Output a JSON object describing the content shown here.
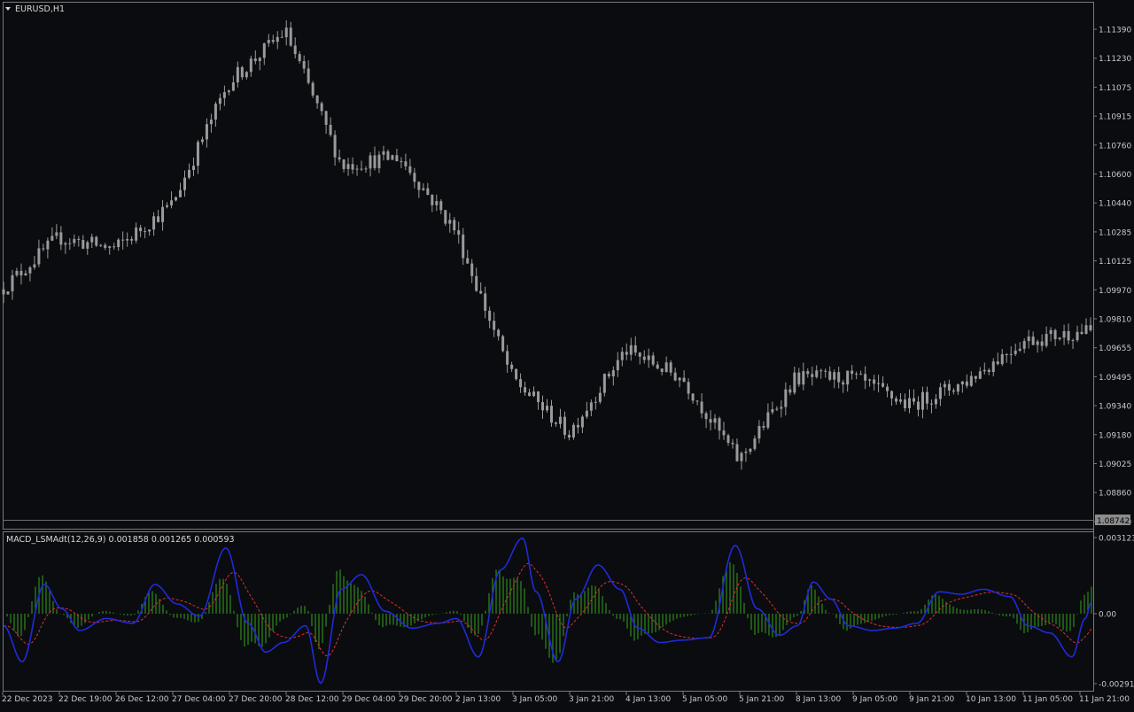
{
  "main_pane": {
    "title": "EURUSD,H1",
    "price_levels": [
      "1.11390",
      "1.11230",
      "1.11075",
      "1.10915",
      "1.10760",
      "1.10600",
      "1.10440",
      "1.10285",
      "1.10125",
      "1.09970",
      "1.09810",
      "1.09655",
      "1.09495",
      "1.09340",
      "1.09180",
      "1.09025",
      "1.08860",
      "1.08700"
    ],
    "current_price": "1.08742"
  },
  "indicator_pane": {
    "title": "MACD_LSMAdt(12,26,9) 0.001858 0.001265 0.000593",
    "levels": [
      "0.003123",
      "0.00",
      "-0.002914"
    ]
  },
  "time_axis": {
    "labels": [
      "22 Dec 2023",
      "22 Dec 19:00",
      "26 Dec 12:00",
      "27 Dec 04:00",
      "27 Dec 20:00",
      "28 Dec 12:00",
      "29 Dec 04:00",
      "29 Dec 20:00",
      "2 Jan 13:00",
      "3 Jan 05:00",
      "3 Jan 21:00",
      "4 Jan 13:00",
      "5 Jan 05:00",
      "5 Jan 21:00",
      "8 Jan 13:00",
      "9 Jan 05:00",
      "9 Jan 21:00",
      "10 Jan 13:00",
      "11 Jan 05:00",
      "11 Jan 21:00"
    ]
  },
  "colors": {
    "background": "#0b0c10",
    "candle": "#9a9a9a",
    "macd_line": "#1f2bd8",
    "signal_line": "#e0302a",
    "histogram": "#2f8a1c",
    "text": "#c8c8c8",
    "border": "#7a7a7a"
  },
  "chart_data": {
    "type": "line",
    "title": "EURUSD,H1",
    "ylim": [
      1.087,
      1.1147
    ],
    "x": [
      "22 Dec 2023",
      "22 Dec 19:00",
      "26 Dec 12:00",
      "27 Dec 04:00",
      "27 Dec 20:00",
      "28 Dec 12:00",
      "29 Dec 04:00",
      "29 Dec 20:00",
      "2 Jan 13:00",
      "3 Jan 05:00",
      "3 Jan 21:00",
      "4 Jan 13:00",
      "5 Jan 05:00",
      "5 Jan 21:00",
      "8 Jan 13:00",
      "9 Jan 05:00",
      "9 Jan 21:00",
      "10 Jan 13:00",
      "11 Jan 05:00",
      "11 Jan 21:00"
    ],
    "series": [
      {
        "values": [
          1.0998,
          1.1026,
          1.102,
          1.1044,
          1.111,
          1.1138,
          1.1065,
          1.107,
          1.103,
          1.095,
          1.092,
          1.0965,
          1.095,
          1.0905,
          1.095,
          1.095,
          1.0935,
          1.0948,
          1.097,
          1.0975
        ]
      }
    ]
  }
}
